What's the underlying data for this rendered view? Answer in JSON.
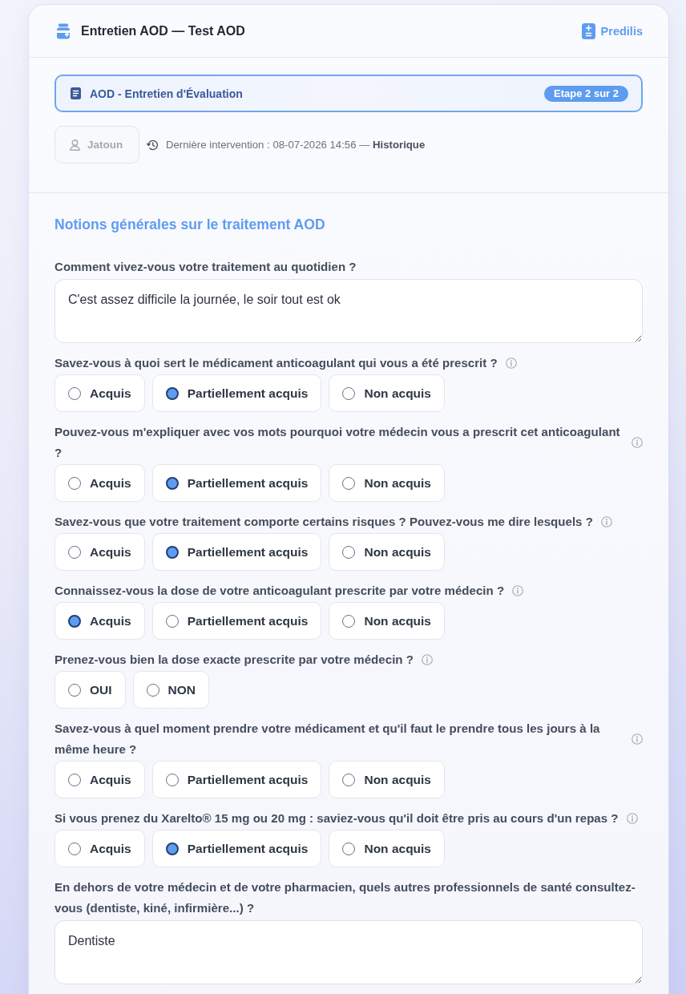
{
  "header": {
    "title": "Entretien AOD — Test AOD",
    "link": "Predilis"
  },
  "step_banner": {
    "title": "AOD - Entretien d'Évaluation",
    "badge": "Etape 2 sur 2"
  },
  "meta": {
    "user": "Jatoun",
    "last_intervention": "Dernière intervention : 08-07-2026 14:56 — **Historique**"
  },
  "section": {
    "title": "Notions générales sur le traitement AOD",
    "questions": [
      {
        "kind": "text",
        "label": "Comment vivez-vous votre traitement au quotidien ?",
        "info": false,
        "value": "C'est assez difficile la journée, le soir tout est ok"
      },
      {
        "kind": "choice",
        "label": "Savez-vous à quoi sert le médicament anticoagulant qui vous a été prescrit ?",
        "info": true,
        "options": [
          {
            "label": "Acquis",
            "selected": false
          },
          {
            "label": "Partiellement acquis",
            "selected": true
          },
          {
            "label": "Non acquis",
            "selected": false
          }
        ]
      },
      {
        "kind": "choice",
        "label": "Pouvez-vous m'expliquer avec vos mots pourquoi votre médecin vous a prescrit cet anticoagulant ?",
        "info": true,
        "options": [
          {
            "label": "Acquis",
            "selected": false
          },
          {
            "label": "Partiellement acquis",
            "selected": true
          },
          {
            "label": "Non acquis",
            "selected": false
          }
        ]
      },
      {
        "kind": "choice",
        "label": "Savez-vous que votre traitement comporte certains risques ? Pouvez-vous me dire lesquels ?",
        "info": true,
        "options": [
          {
            "label": "Acquis",
            "selected": false
          },
          {
            "label": "Partiellement acquis",
            "selected": true
          },
          {
            "label": "Non acquis",
            "selected": false
          }
        ]
      },
      {
        "kind": "choice",
        "label": "Connaissez-vous la dose de votre anticoagulant prescrite par votre médecin ?",
        "info": true,
        "options": [
          {
            "label": "Acquis",
            "selected": true
          },
          {
            "label": "Partiellement acquis",
            "selected": false
          },
          {
            "label": "Non acquis",
            "selected": false
          }
        ]
      },
      {
        "kind": "choice",
        "label": "Prenez-vous bien la dose exacte prescrite par votre médecin ?",
        "info": true,
        "options": [
          {
            "label": "OUI",
            "selected": false
          },
          {
            "label": "NON",
            "selected": false
          }
        ]
      },
      {
        "kind": "choice",
        "label": "Savez-vous à quel moment prendre votre médicament et qu'il faut le prendre tous les jours à la même heure ?",
        "info": true,
        "options": [
          {
            "label": "Acquis",
            "selected": false
          },
          {
            "label": "Partiellement acquis",
            "selected": false
          },
          {
            "label": "Non acquis",
            "selected": false
          }
        ]
      },
      {
        "kind": "choice",
        "label": "Si vous prenez du Xarelto® 15 mg ou 20 mg : saviez-vous qu'il doit être pris au cours d'un repas ?",
        "info": true,
        "options": [
          {
            "label": "Acquis",
            "selected": false
          },
          {
            "label": "Partiellement acquis",
            "selected": true
          },
          {
            "label": "Non acquis",
            "selected": false
          }
        ]
      },
      {
        "kind": "text",
        "label": "En dehors de votre médecin et de votre pharmacien, quels autres professionnels de santé consultez-vous (dentiste, kiné, infirmière...) ?",
        "info": false,
        "value": "Dentiste"
      }
    ]
  }
}
